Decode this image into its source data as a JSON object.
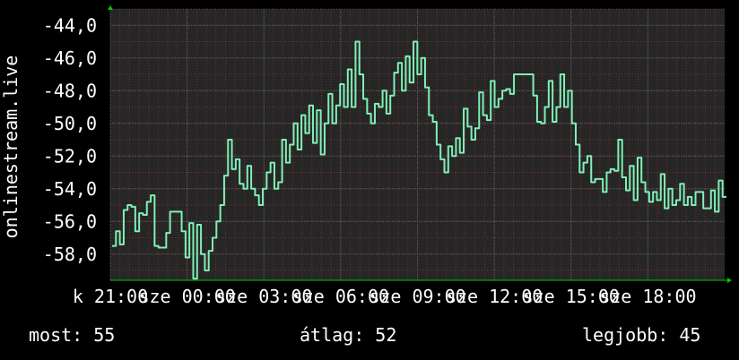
{
  "chart_data": {
    "type": "line",
    "ylabel": "onlinestream.live",
    "ylim": [
      -59.6,
      -43.0
    ],
    "yticks": [
      "-44,0",
      "-46,0",
      "-48,0",
      "-50,0",
      "-52,0",
      "-54,0",
      "-56,0",
      "-58,0"
    ],
    "ytick_values": [
      -44,
      -46,
      -48,
      -50,
      -52,
      -54,
      -56,
      -58
    ],
    "xticks": [
      {
        "label": "k 21:00",
        "pos": 0.0
      },
      {
        "label": "sze 00:00",
        "pos": 0.125
      },
      {
        "label": "sze 03:00",
        "pos": 0.25
      },
      {
        "label": "sze 06:00",
        "pos": 0.375
      },
      {
        "label": "sze 09:00",
        "pos": 0.5
      },
      {
        "label": "sze 12:00",
        "pos": 0.625
      },
      {
        "label": "sze 15:00",
        "pos": 0.75
      },
      {
        "label": "sze 18:00",
        "pos": 0.875
      }
    ],
    "grid": true,
    "colors": {
      "background": "#262626",
      "line": "#7ff0b5",
      "grid_major": "#595959",
      "grid_minor": "#7a2f2f",
      "axis_arrow": "#00cc00"
    },
    "series": [
      {
        "values": [
          -57.5,
          -56.6,
          -57.4,
          -55.3,
          -55.0,
          -55.1,
          -56.6,
          -55.5,
          -55.6,
          -54.8,
          -54.4,
          -57.5,
          -57.6,
          -57.6,
          -56.7,
          -55.4,
          -55.4,
          -55.4,
          -56.6,
          -58.2,
          -56.1,
          -59.5,
          -56.2,
          -58.0,
          -59.0,
          -57.8,
          -57.0,
          -56.0,
          -55.0,
          -53.2,
          -51.0,
          -52.8,
          -52.2,
          -53.7,
          -54.0,
          -52.6,
          -54.0,
          -54.4,
          -55.0,
          -54.0,
          -53.0,
          -52.4,
          -54.0,
          -53.6,
          -51.0,
          -52.4,
          -51.3,
          -50.0,
          -51.6,
          -49.5,
          -50.6,
          -48.9,
          -51.2,
          -49.2,
          -51.9,
          -50.0,
          -48.2,
          -50.0,
          -48.9,
          -47.6,
          -49.0,
          -46.7,
          -49.0,
          -45.0,
          -47.0,
          -48.5,
          -49.4,
          -50.0,
          -48.8,
          -49.0,
          -48.0,
          -49.4,
          -48.3,
          -46.9,
          -46.3,
          -48.0,
          -45.9,
          -47.5,
          -45.0,
          -47.0,
          -46.0,
          -47.8,
          -49.5,
          -49.9,
          -51.3,
          -52.2,
          -53.0,
          -51.4,
          -52.0,
          -50.9,
          -51.8,
          -49.1,
          -50.2,
          -51.0,
          -50.3,
          -48.1,
          -49.5,
          -49.8,
          -47.4,
          -49.0,
          -48.5,
          -48.0,
          -47.9,
          -48.2,
          -47.0,
          -47.0,
          -47.0,
          -47.0,
          -47.0,
          -48.3,
          -49.9,
          -50.0,
          -49.0,
          -47.4,
          -49.9,
          -49.0,
          -47.0,
          -49.0,
          -48.0,
          -50.0,
          -51.3,
          -53.0,
          -52.4,
          -52.0,
          -53.6,
          -53.4,
          -53.4,
          -54.2,
          -53.0,
          -52.8,
          -52.9,
          -51.0,
          -53.3,
          -54.1,
          -52.6,
          -54.7,
          -52.1,
          -53.6,
          -54.2,
          -54.8,
          -54.2,
          -54.7,
          -53.1,
          -55.2,
          -54.0,
          -55.0,
          -54.7,
          -53.7,
          -55.0,
          -54.5,
          -55.0,
          -54.2,
          -54.2,
          -55.2,
          -55.2,
          -54.1,
          -55.4,
          -53.5,
          -54.5
        ],
        "color": "#7ff0b5"
      }
    ]
  },
  "footer": {
    "now": "most: 55",
    "avg": "átlag: 52",
    "max": "legjobb: 45"
  }
}
